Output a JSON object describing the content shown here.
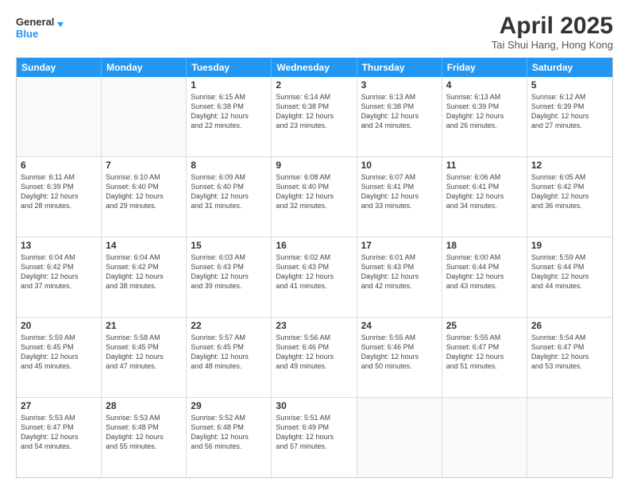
{
  "logo": {
    "line1": "General",
    "line2": "Blue"
  },
  "title": "April 2025",
  "subtitle": "Tai Shui Hang, Hong Kong",
  "header_days": [
    "Sunday",
    "Monday",
    "Tuesday",
    "Wednesday",
    "Thursday",
    "Friday",
    "Saturday"
  ],
  "weeks": [
    [
      {
        "day": "",
        "empty": true
      },
      {
        "day": "",
        "empty": true
      },
      {
        "day": "1",
        "sunrise": "6:15 AM",
        "sunset": "6:38 PM",
        "daylight": "12 hours and 22 minutes."
      },
      {
        "day": "2",
        "sunrise": "6:14 AM",
        "sunset": "6:38 PM",
        "daylight": "12 hours and 23 minutes."
      },
      {
        "day": "3",
        "sunrise": "6:13 AM",
        "sunset": "6:38 PM",
        "daylight": "12 hours and 24 minutes."
      },
      {
        "day": "4",
        "sunrise": "6:13 AM",
        "sunset": "6:39 PM",
        "daylight": "12 hours and 26 minutes."
      },
      {
        "day": "5",
        "sunrise": "6:12 AM",
        "sunset": "6:39 PM",
        "daylight": "12 hours and 27 minutes."
      }
    ],
    [
      {
        "day": "6",
        "sunrise": "6:11 AM",
        "sunset": "6:39 PM",
        "daylight": "12 hours and 28 minutes."
      },
      {
        "day": "7",
        "sunrise": "6:10 AM",
        "sunset": "6:40 PM",
        "daylight": "12 hours and 29 minutes."
      },
      {
        "day": "8",
        "sunrise": "6:09 AM",
        "sunset": "6:40 PM",
        "daylight": "12 hours and 31 minutes."
      },
      {
        "day": "9",
        "sunrise": "6:08 AM",
        "sunset": "6:40 PM",
        "daylight": "12 hours and 32 minutes."
      },
      {
        "day": "10",
        "sunrise": "6:07 AM",
        "sunset": "6:41 PM",
        "daylight": "12 hours and 33 minutes."
      },
      {
        "day": "11",
        "sunrise": "6:06 AM",
        "sunset": "6:41 PM",
        "daylight": "12 hours and 34 minutes."
      },
      {
        "day": "12",
        "sunrise": "6:05 AM",
        "sunset": "6:42 PM",
        "daylight": "12 hours and 36 minutes."
      }
    ],
    [
      {
        "day": "13",
        "sunrise": "6:04 AM",
        "sunset": "6:42 PM",
        "daylight": "12 hours and 37 minutes."
      },
      {
        "day": "14",
        "sunrise": "6:04 AM",
        "sunset": "6:42 PM",
        "daylight": "12 hours and 38 minutes."
      },
      {
        "day": "15",
        "sunrise": "6:03 AM",
        "sunset": "6:43 PM",
        "daylight": "12 hours and 39 minutes."
      },
      {
        "day": "16",
        "sunrise": "6:02 AM",
        "sunset": "6:43 PM",
        "daylight": "12 hours and 41 minutes."
      },
      {
        "day": "17",
        "sunrise": "6:01 AM",
        "sunset": "6:43 PM",
        "daylight": "12 hours and 42 minutes."
      },
      {
        "day": "18",
        "sunrise": "6:00 AM",
        "sunset": "6:44 PM",
        "daylight": "12 hours and 43 minutes."
      },
      {
        "day": "19",
        "sunrise": "5:59 AM",
        "sunset": "6:44 PM",
        "daylight": "12 hours and 44 minutes."
      }
    ],
    [
      {
        "day": "20",
        "sunrise": "5:59 AM",
        "sunset": "6:45 PM",
        "daylight": "12 hours and 45 minutes."
      },
      {
        "day": "21",
        "sunrise": "5:58 AM",
        "sunset": "6:45 PM",
        "daylight": "12 hours and 47 minutes."
      },
      {
        "day": "22",
        "sunrise": "5:57 AM",
        "sunset": "6:45 PM",
        "daylight": "12 hours and 48 minutes."
      },
      {
        "day": "23",
        "sunrise": "5:56 AM",
        "sunset": "6:46 PM",
        "daylight": "12 hours and 49 minutes."
      },
      {
        "day": "24",
        "sunrise": "5:55 AM",
        "sunset": "6:46 PM",
        "daylight": "12 hours and 50 minutes."
      },
      {
        "day": "25",
        "sunrise": "5:55 AM",
        "sunset": "6:47 PM",
        "daylight": "12 hours and 51 minutes."
      },
      {
        "day": "26",
        "sunrise": "5:54 AM",
        "sunset": "6:47 PM",
        "daylight": "12 hours and 53 minutes."
      }
    ],
    [
      {
        "day": "27",
        "sunrise": "5:53 AM",
        "sunset": "6:47 PM",
        "daylight": "12 hours and 54 minutes."
      },
      {
        "day": "28",
        "sunrise": "5:53 AM",
        "sunset": "6:48 PM",
        "daylight": "12 hours and 55 minutes."
      },
      {
        "day": "29",
        "sunrise": "5:52 AM",
        "sunset": "6:48 PM",
        "daylight": "12 hours and 56 minutes."
      },
      {
        "day": "30",
        "sunrise": "5:51 AM",
        "sunset": "6:49 PM",
        "daylight": "12 hours and 57 minutes."
      },
      {
        "day": "",
        "empty": true
      },
      {
        "day": "",
        "empty": true
      },
      {
        "day": "",
        "empty": true
      }
    ]
  ]
}
